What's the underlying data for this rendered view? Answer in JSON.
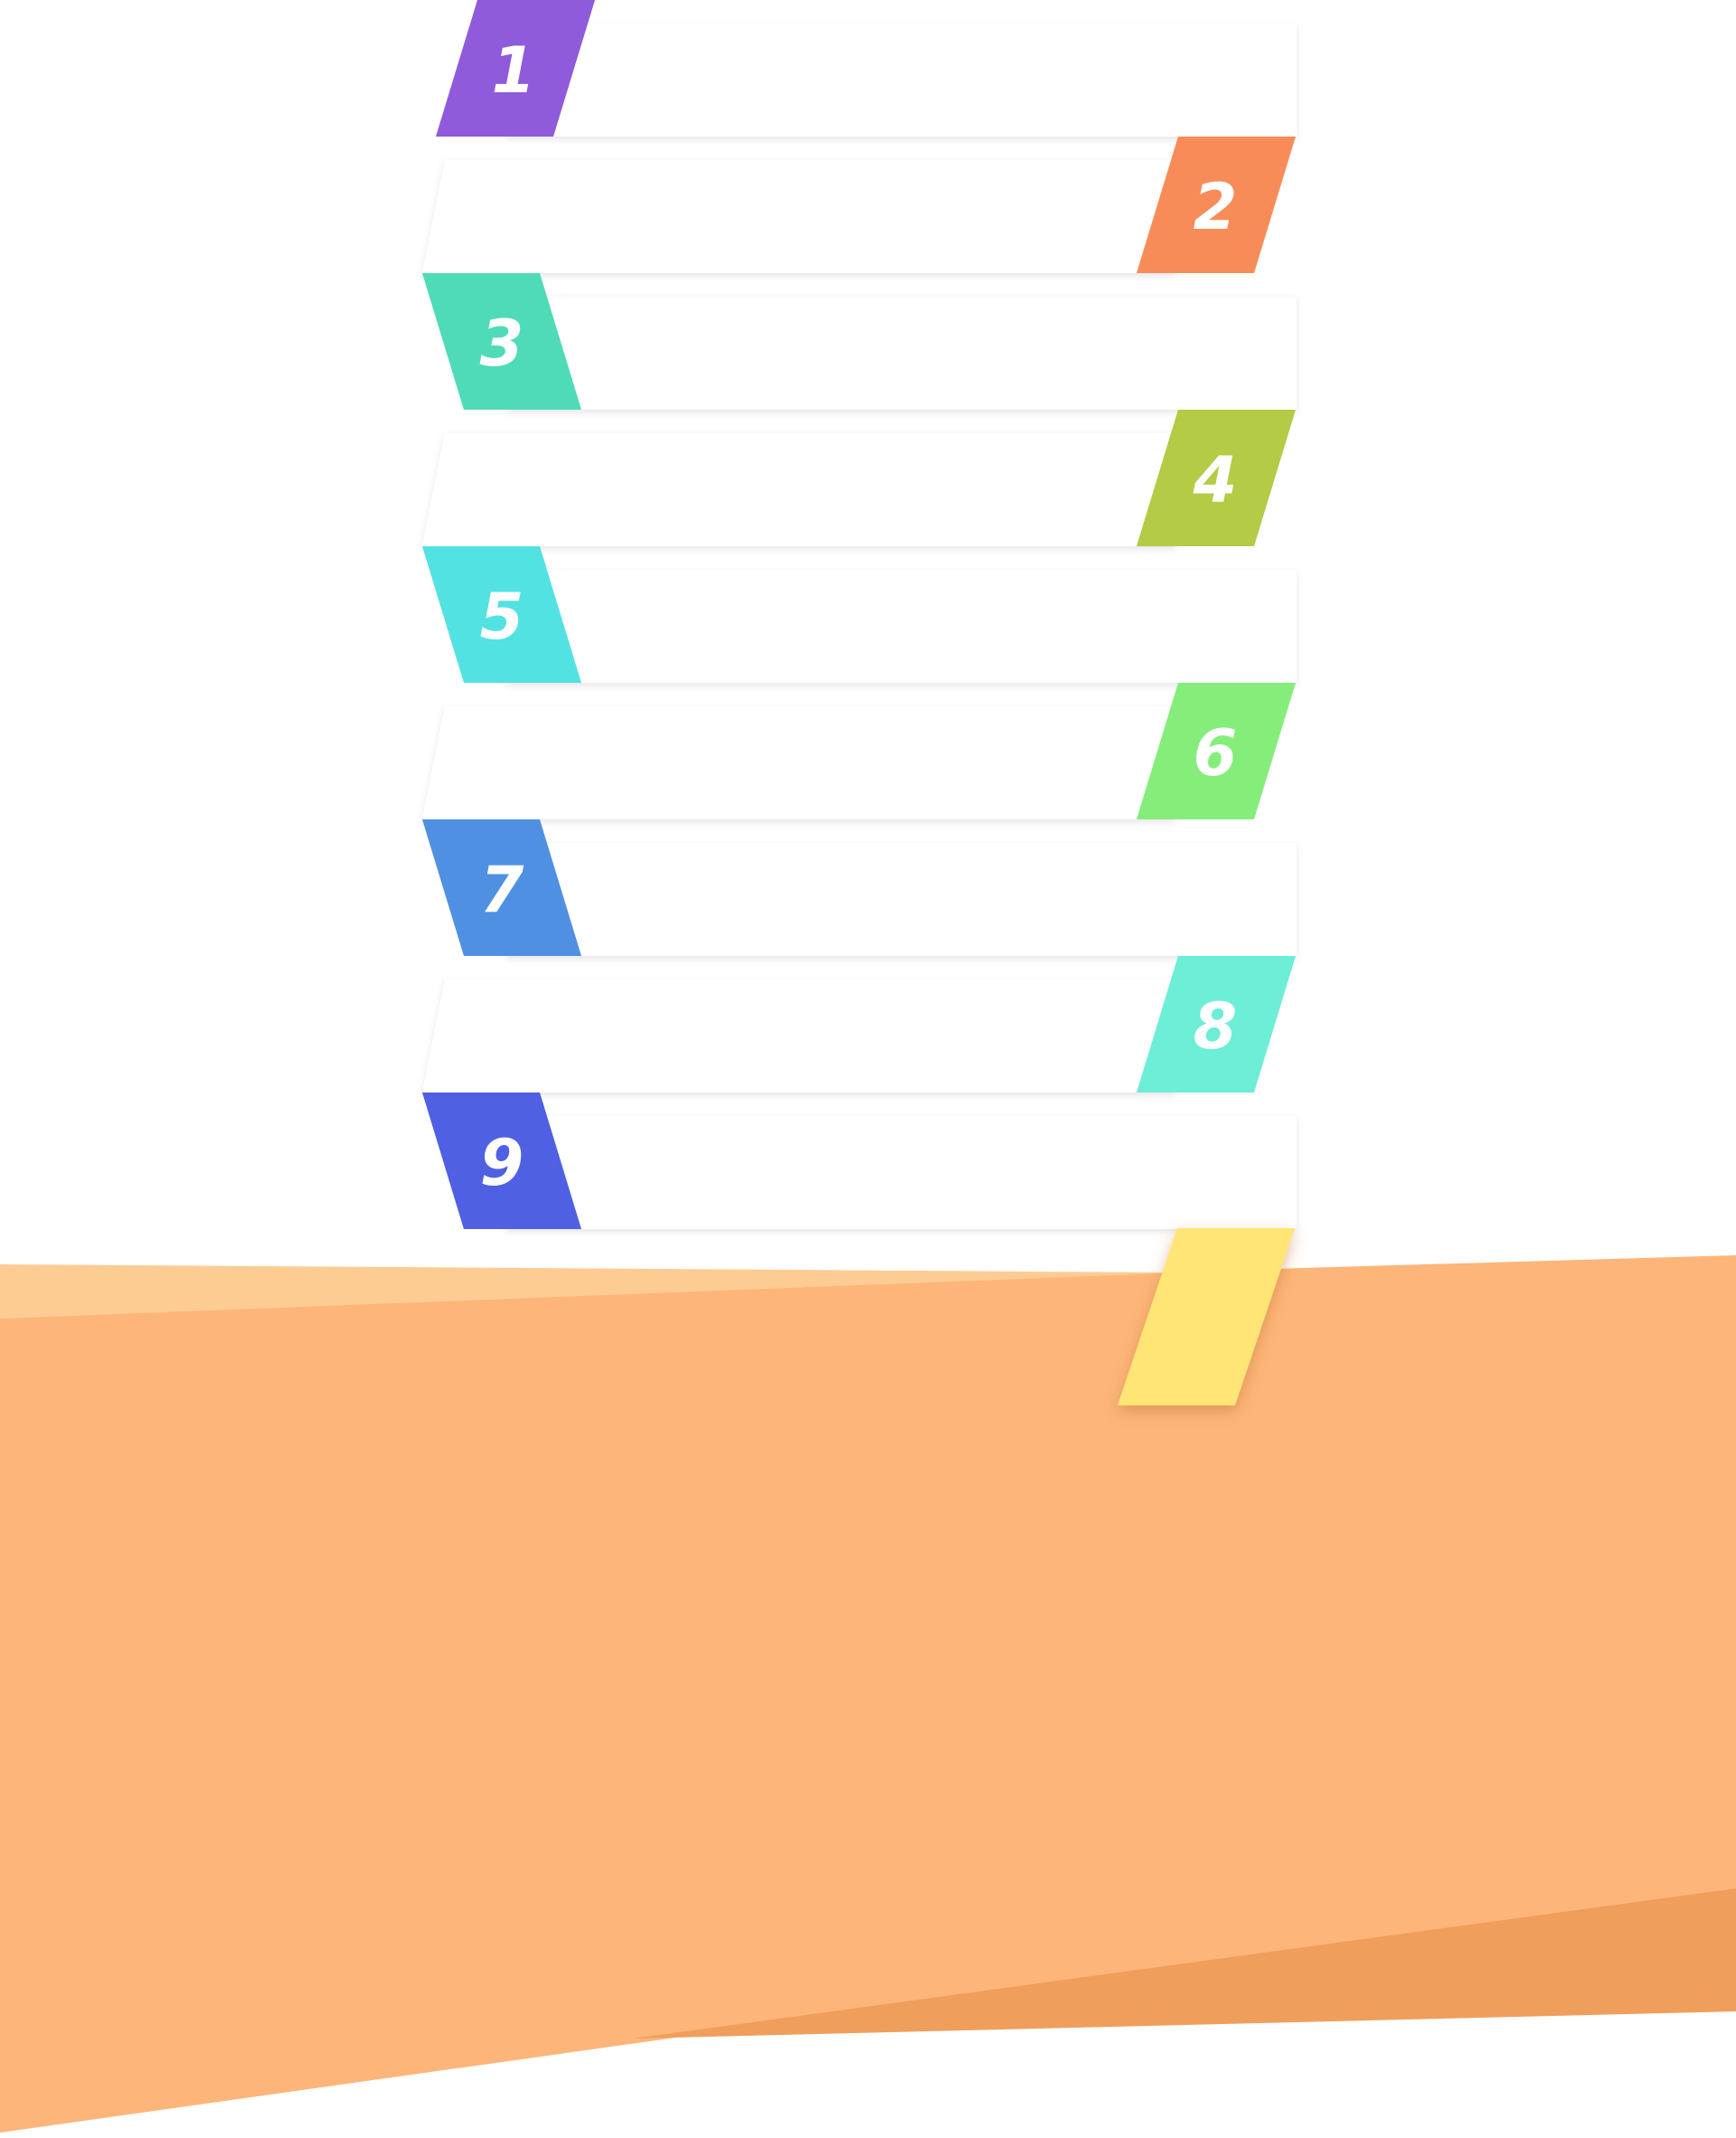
{
  "steps": [
    {
      "number": "1",
      "color": "#8F5BDB",
      "tab_side": "left"
    },
    {
      "number": "2",
      "color": "#F88C58",
      "tab_side": "right"
    },
    {
      "number": "3",
      "color": "#4FDBB8",
      "tab_side": "left"
    },
    {
      "number": "4",
      "color": "#B3CB45",
      "tab_side": "right"
    },
    {
      "number": "5",
      "color": "#53E2E2",
      "tab_side": "left"
    },
    {
      "number": "6",
      "color": "#85EE7B",
      "tab_side": "right"
    },
    {
      "number": "7",
      "color": "#5090E2",
      "tab_side": "left"
    },
    {
      "number": "8",
      "color": "#6DEED6",
      "tab_side": "right"
    },
    {
      "number": "9",
      "color": "#4F60E2",
      "tab_side": "left"
    }
  ],
  "yellow_tab": {
    "color": "#FEE576"
  },
  "ground": {
    "main_color": "#FDB579",
    "light_color": "#FDCC93",
    "dark_color": "#EF9F5B"
  }
}
